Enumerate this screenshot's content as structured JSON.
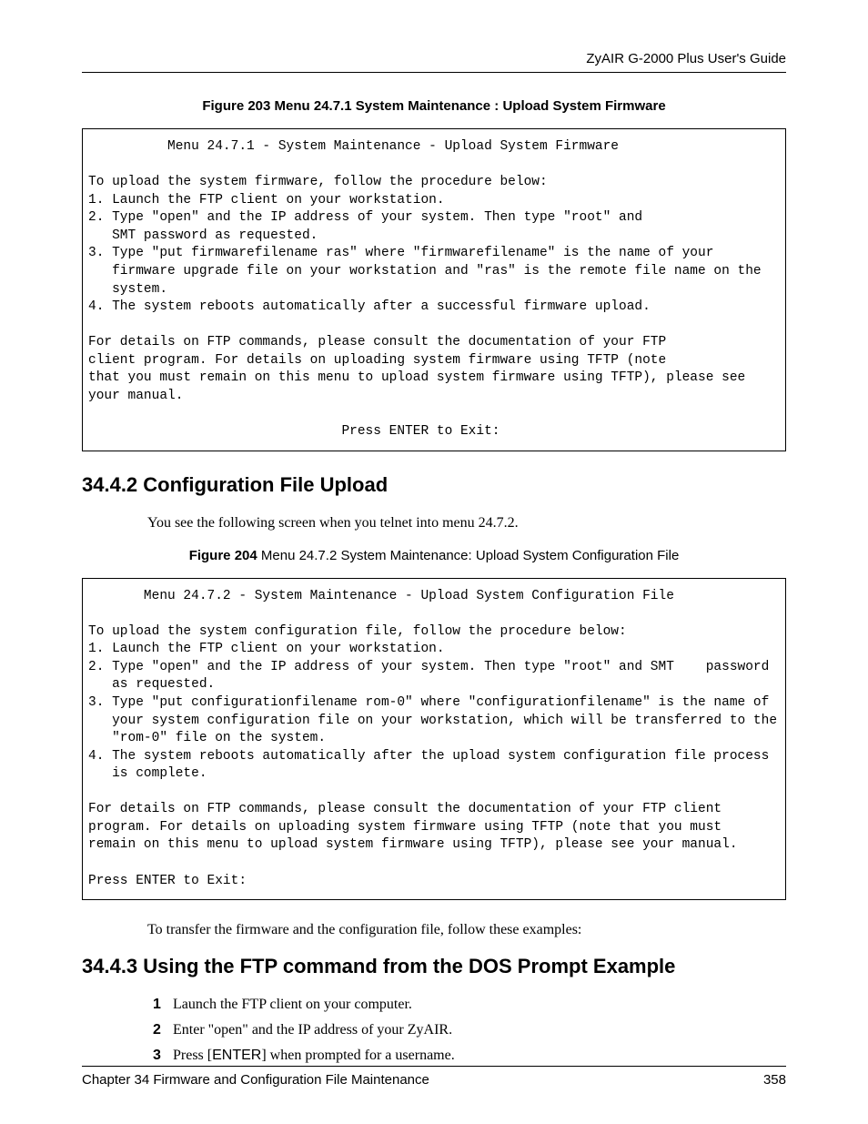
{
  "header": {
    "guide_title": "ZyAIR G-2000 Plus User's Guide"
  },
  "figure203": {
    "caption_bold": "Figure 203   Menu 24.7.1 System Maintenance : Upload System Firmware",
    "code": "          Menu 24.7.1 - System Maintenance - Upload System Firmware\n\nTo upload the system firmware, follow the procedure below:\n1. Launch the FTP client on your workstation.\n2. Type \"open\" and the IP address of your system. Then type \"root\" and\n   SMT password as requested.\n3. Type \"put firmwarefilename ras\" where \"firmwarefilename\" is the name of your\n   firmware upgrade file on your workstation and \"ras\" is the remote file name on the\n   system.\n4. The system reboots automatically after a successful firmware upload.\n\nFor details on FTP commands, please consult the documentation of your FTP\nclient program. For details on uploading system firmware using TFTP (note\nthat you must remain on this menu to upload system firmware using TFTP), please see\nyour manual.\n\n                                Press ENTER to Exit:"
  },
  "section342": {
    "heading": "34.4.2  Configuration File Upload",
    "para": "You see the following screen when you telnet into menu 24.7.2."
  },
  "figure204": {
    "caption_bold": "Figure 204   ",
    "caption_normal": "Menu 24.7.2 System Maintenance: Upload System Configuration File",
    "code": "       Menu 24.7.2 - System Maintenance - Upload System Configuration File\n\nTo upload the system configuration file, follow the procedure below:\n1. Launch the FTP client on your workstation.\n2. Type \"open\" and the IP address of your system. Then type \"root\" and SMT    password\n   as requested.\n3. Type \"put configurationfilename rom-0\" where \"configurationfilename\" is the name of\n   your system configuration file on your workstation, which will be transferred to the\n   \"rom-0\" file on the system.\n4. The system reboots automatically after the upload system configuration file process\n   is complete.\n\nFor details on FTP commands, please consult the documentation of your FTP client\nprogram. For details on uploading system firmware using TFTP (note that you must\nremain on this menu to upload system firmware using TFTP), please see your manual.\n\nPress ENTER to Exit:"
  },
  "transfer_para": "To transfer the firmware and the configuration file, follow these examples:",
  "section343": {
    "heading": "34.4.3  Using the FTP command from the DOS Prompt Example",
    "steps": [
      {
        "num": "1",
        "text": "Launch the FTP client on your computer."
      },
      {
        "num": "2",
        "text": "Enter \"open\" and the IP address of your ZyAIR."
      },
      {
        "num": "3",
        "text_before": "Press [",
        "enter": "ENTER",
        "text_after": "] when prompted for a username."
      }
    ]
  },
  "footer": {
    "chapter": "Chapter 34 Firmware and Configuration File Maintenance",
    "page": "358"
  }
}
